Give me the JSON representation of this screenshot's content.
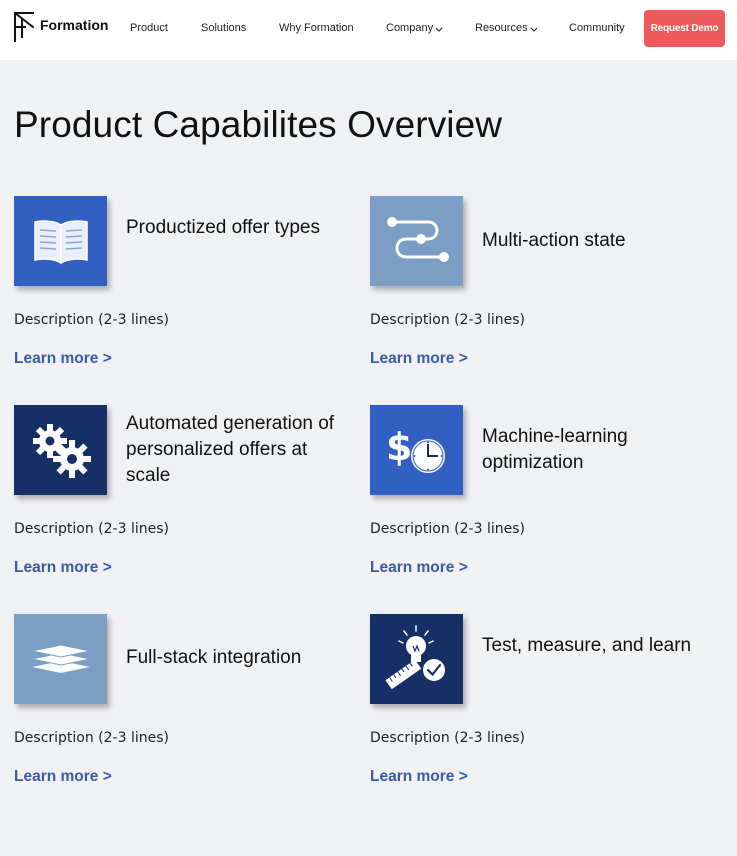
{
  "brand": {
    "name": "Formation"
  },
  "nav": {
    "items": [
      {
        "label": "Product",
        "has_dropdown": false
      },
      {
        "label": "Solutions",
        "has_dropdown": false
      },
      {
        "label": "Why Formation",
        "has_dropdown": false
      },
      {
        "label": "Company",
        "has_dropdown": true
      },
      {
        "label": "Resources",
        "has_dropdown": true
      },
      {
        "label": "Community",
        "has_dropdown": false
      }
    ],
    "cta_label": "Request Demo"
  },
  "colors": {
    "cta": "#ee5a5b",
    "link": "#3a5aa8",
    "tile_blue": "#3160c2",
    "tile_light": "#7c9ec5",
    "tile_navy": "#163066",
    "background": "#f0f1f3"
  },
  "page": {
    "title": "Product Capabilites Overview"
  },
  "cards": [
    {
      "title": "Productized offer types",
      "icon": "open-book-icon",
      "tile_color": "blue",
      "description": "Description (2-3 lines)",
      "link": "Learn more >"
    },
    {
      "title": "Multi-action state",
      "icon": "path-route-icon",
      "tile_color": "light",
      "description": "Description (2-3 lines)",
      "link": "Learn more >"
    },
    {
      "title": "Automated generation of personalized offers at scale",
      "icon": "gears-icon",
      "tile_color": "navy",
      "description": "Description (2-3 lines)",
      "link": "Learn more >"
    },
    {
      "title": "Machine-learning optimization",
      "icon": "dollar-clock-icon",
      "tile_color": "blue",
      "description": "Description (2-3 lines)",
      "link": "Learn more >"
    },
    {
      "title": "Full-stack integration",
      "icon": "layers-stack-icon",
      "tile_color": "light",
      "description": "Description (2-3 lines)",
      "link": "Learn more >"
    },
    {
      "title": "Test, measure, and learn",
      "icon": "lightbulb-ruler-check-icon",
      "tile_color": "navy",
      "description": "Description (2-3 lines)",
      "link": "Learn more >"
    }
  ]
}
